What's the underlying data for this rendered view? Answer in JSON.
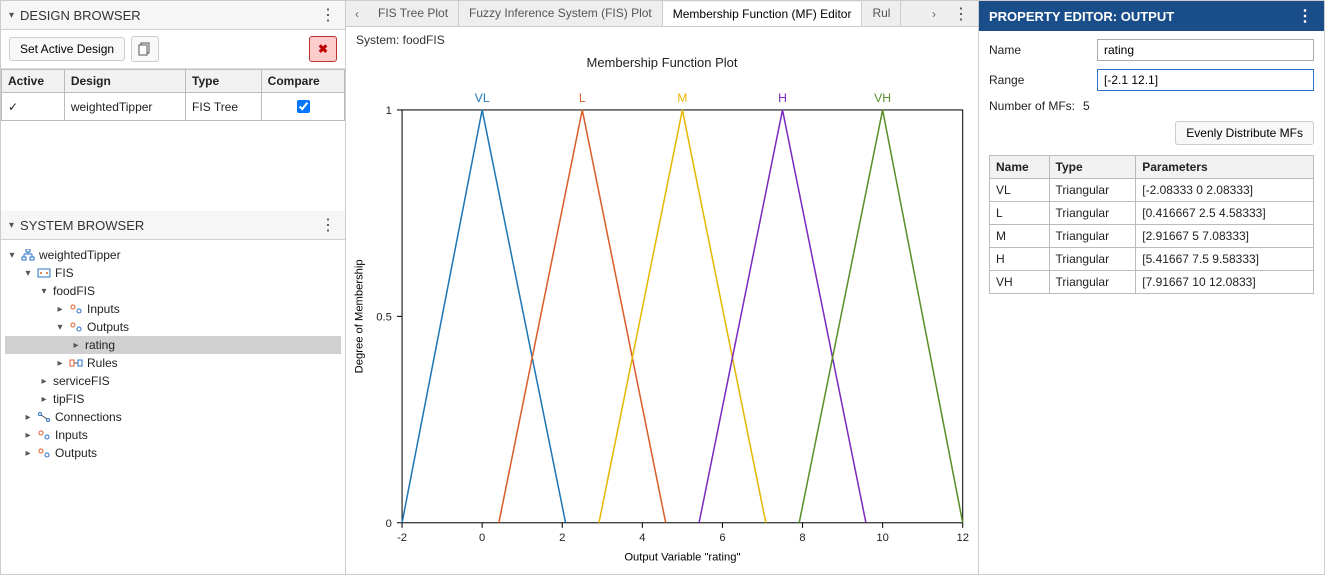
{
  "colors": {
    "VL": "#1f77b4",
    "L": "#d95f2c",
    "M": "#e6b800",
    "H": "#7b2cbf",
    "VH": "#5a8f29"
  },
  "left": {
    "design_browser": {
      "title": "DESIGN BROWSER",
      "set_active": "Set Active Design",
      "cols": {
        "active": "Active",
        "design": "Design",
        "type": "Type",
        "compare": "Compare"
      },
      "rows": [
        {
          "active": "✓",
          "design": "weightedTipper",
          "type": "FIS Tree",
          "compare": true
        }
      ]
    },
    "system_browser": {
      "title": "SYSTEM BROWSER",
      "root": "weightedTipper",
      "fis": "FIS",
      "foodFIS": "foodFIS",
      "inputs": "Inputs",
      "outputs": "Outputs",
      "rating": "rating",
      "rules": "Rules",
      "serviceFIS": "serviceFIS",
      "tipFIS": "tipFIS",
      "connections": "Connections",
      "inputs2": "Inputs",
      "outputs2": "Outputs"
    }
  },
  "center": {
    "tabs": [
      {
        "label": "FIS Tree Plot",
        "active": false
      },
      {
        "label": "Fuzzy Inference System (FIS) Plot",
        "active": false
      },
      {
        "label": "Membership Function (MF) Editor",
        "active": true
      },
      {
        "label": "Rul",
        "active": false
      }
    ],
    "system_label": "System: foodFIS",
    "plot_title": "Membership Function Plot"
  },
  "right": {
    "title": "PROPERTY EDITOR: OUTPUT",
    "name_label": "Name",
    "name_value": "rating",
    "range_label": "Range",
    "range_value": "[-2.1 12.1]",
    "nmf_label": "Number of MFs:",
    "nmf_value": "5",
    "dist_btn": "Evenly Distribute MFs",
    "mf_cols": {
      "name": "Name",
      "type": "Type",
      "params": "Parameters"
    },
    "mfs": [
      {
        "name": "VL",
        "type": "Triangular",
        "params": "[-2.08333 0 2.08333]"
      },
      {
        "name": "L",
        "type": "Triangular",
        "params": "[0.416667 2.5 4.58333]"
      },
      {
        "name": "M",
        "type": "Triangular",
        "params": "[2.91667 5 7.08333]"
      },
      {
        "name": "H",
        "type": "Triangular",
        "params": "[5.41667 7.5 9.58333]"
      },
      {
        "name": "VH",
        "type": "Triangular",
        "params": "[7.91667 10 12.0833]"
      }
    ]
  },
  "chart_data": {
    "type": "line",
    "title": "Membership Function Plot",
    "xlabel": "Output Variable \"rating\"",
    "ylabel": "Degree of Membership",
    "xlim": [
      -2,
      12
    ],
    "ylim": [
      0,
      1
    ],
    "xticks": [
      -2,
      0,
      2,
      4,
      6,
      8,
      10,
      12
    ],
    "yticks": [
      0,
      0.5,
      1
    ],
    "series": [
      {
        "name": "VL",
        "color": "#1f77b4",
        "x": [
          -2.08333,
          0,
          2.08333
        ],
        "y": [
          0,
          1,
          0
        ]
      },
      {
        "name": "L",
        "color": "#d95f2c",
        "x": [
          0.416667,
          2.5,
          4.58333
        ],
        "y": [
          0,
          1,
          0
        ]
      },
      {
        "name": "M",
        "color": "#e6b800",
        "x": [
          2.91667,
          5,
          7.08333
        ],
        "y": [
          0,
          1,
          0
        ]
      },
      {
        "name": "H",
        "color": "#7b2cbf",
        "x": [
          5.41667,
          7.5,
          9.58333
        ],
        "y": [
          0,
          1,
          0
        ]
      },
      {
        "name": "VH",
        "color": "#5a8f29",
        "x": [
          7.91667,
          10,
          12.0833
        ],
        "y": [
          0,
          1,
          0
        ]
      }
    ]
  }
}
